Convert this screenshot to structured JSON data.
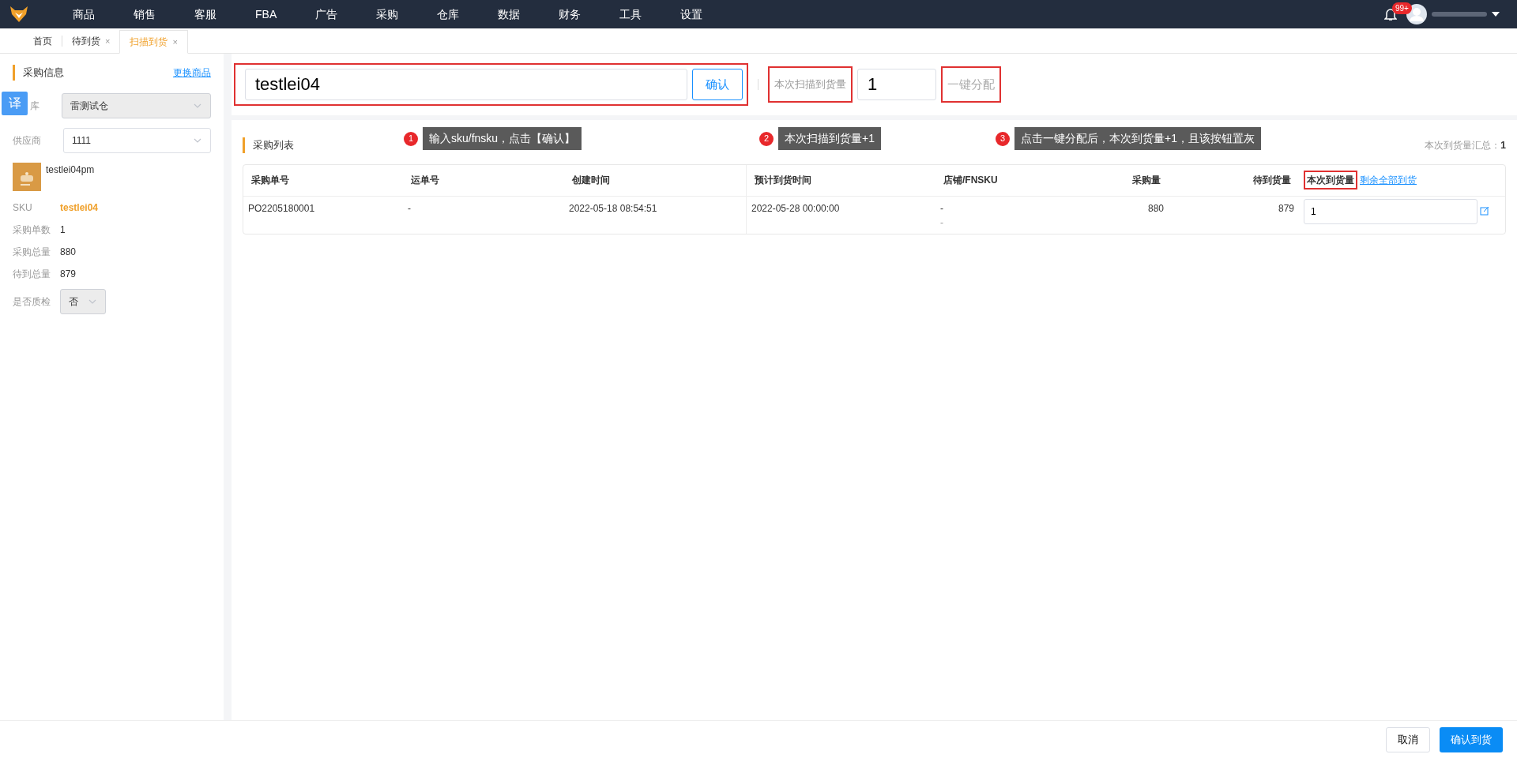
{
  "nav": {
    "items": [
      "商品",
      "销售",
      "客服",
      "FBA",
      "广告",
      "采购",
      "仓库",
      "数据",
      "财务",
      "工具",
      "设置"
    ],
    "badge": "99+"
  },
  "tabs": [
    {
      "label": "首页",
      "selected": false
    },
    {
      "label": "待到货",
      "selected": false,
      "close": "×"
    },
    {
      "label": "扫描到货",
      "selected": true,
      "close": "×"
    }
  ],
  "sidebar": {
    "title": "采购信息",
    "link": "更换商品",
    "translate": "译",
    "warehouse": {
      "label": "库",
      "value": "雷测试仓",
      "disabled": true
    },
    "supplier": {
      "label": "供应商",
      "value": "1111",
      "disabled": false
    },
    "product_name": "testlei04pm",
    "facts": [
      {
        "label": "SKU",
        "value": "testlei04",
        "kind": "sku"
      },
      {
        "label": "采购单数",
        "value": "1",
        "kind": "plain"
      },
      {
        "label": "采购总量",
        "value": "880",
        "kind": "plain"
      },
      {
        "label": "待到总量",
        "value": "879",
        "kind": "plain"
      }
    ],
    "inspection": {
      "label": "是否质检",
      "value": "否"
    }
  },
  "scan": {
    "value": "testlei04",
    "confirm": "确认",
    "qty_label": "本次扫描到货量",
    "qty_value": "1",
    "allocate": "一键分配",
    "allocate_disabled": true,
    "highlighted": true
  },
  "annotations": [
    {
      "number": "1",
      "text": "输入sku/fnsku，点击【确认】"
    },
    {
      "number": "2",
      "text": "本次扫描到货量+1"
    },
    {
      "number": "3",
      "text": "点击一键分配后，本次到货量+1，且该按钮置灰"
    }
  ],
  "table": {
    "title": "采购列表",
    "summary_label": "本次到货量汇总：",
    "summary_value": "1",
    "columns": [
      {
        "label": "采购单号",
        "highlighted": false
      },
      {
        "label": "运单号",
        "highlighted": false
      },
      {
        "label": "创建时间",
        "highlighted": false
      },
      {
        "label": "预计到货时间",
        "highlighted": false
      },
      {
        "label": "店铺/FNSKU",
        "highlighted": false
      },
      {
        "label": "采购量",
        "highlighted": false
      },
      {
        "label": "待到货量",
        "highlighted": false
      },
      {
        "label": "本次到货量",
        "highlighted": true
      }
    ],
    "column_link": "剩余全部到货",
    "rows": [
      {
        "cells": [
          "PO2205180001",
          "-",
          "2022-05-18 08:54:51",
          "2022-05-28 00:00:00",
          "-",
          "880",
          "879"
        ],
        "shop_sub": "-",
        "arrive": "1"
      }
    ]
  },
  "footer": {
    "cancel": "取消",
    "submit": "确认到货"
  }
}
